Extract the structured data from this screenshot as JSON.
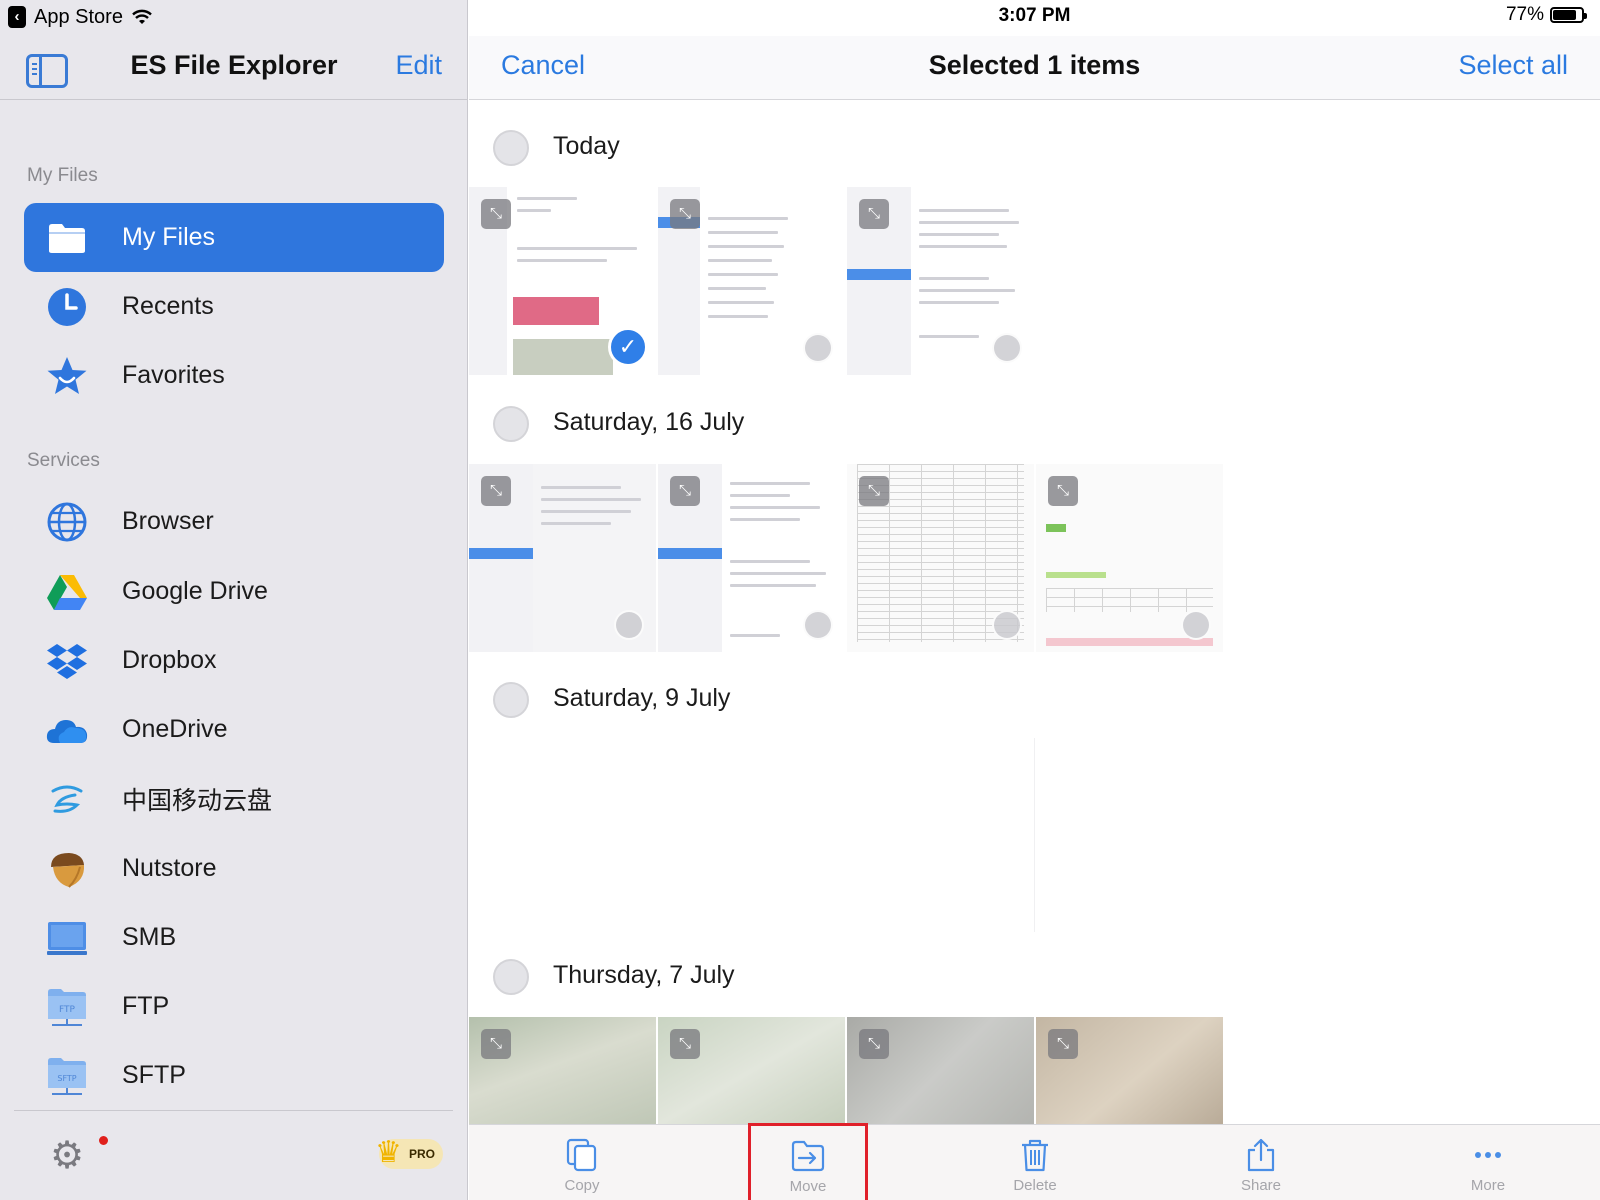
{
  "status_bar": {
    "back_app": "App Store",
    "time": "3:07 PM",
    "battery_percent": "77%",
    "battery_level": 0.77
  },
  "sidebar": {
    "title": "ES File Explorer",
    "edit_label": "Edit",
    "my_files_section": "My Files",
    "services_section": "Services",
    "items": [
      {
        "label": "My Files",
        "icon": "folder-icon",
        "active": true
      },
      {
        "label": "Recents",
        "icon": "clock-icon"
      },
      {
        "label": "Favorites",
        "icon": "star-icon"
      }
    ],
    "services": [
      {
        "label": "Browser",
        "icon": "globe-icon"
      },
      {
        "label": "Google Drive",
        "icon": "google-drive-icon"
      },
      {
        "label": "Dropbox",
        "icon": "dropbox-icon"
      },
      {
        "label": "OneDrive",
        "icon": "onedrive-icon"
      },
      {
        "label": "中国移动云盘",
        "icon": "china-mobile-cloud-icon"
      },
      {
        "label": "Nutstore",
        "icon": "nutstore-icon"
      },
      {
        "label": "SMB",
        "icon": "smb-icon"
      },
      {
        "label": "FTP",
        "icon": "ftp-folder-icon"
      },
      {
        "label": "SFTP",
        "icon": "sftp-folder-icon"
      }
    ],
    "pro_badge": "PRO",
    "accent": "#2f76dd"
  },
  "main": {
    "cancel_label": "Cancel",
    "title": "Selected 1 items",
    "select_all_label": "Select all",
    "groups": [
      {
        "title": "Today"
      },
      {
        "title": "Saturday, 16 July"
      },
      {
        "title": "Saturday, 9 July"
      },
      {
        "title": "Thursday, 7 July"
      }
    ]
  },
  "toolbar": {
    "copy": "Copy",
    "move": "Move",
    "delete": "Delete",
    "share": "Share",
    "more": "More",
    "highlight_color": "#e0202a"
  }
}
